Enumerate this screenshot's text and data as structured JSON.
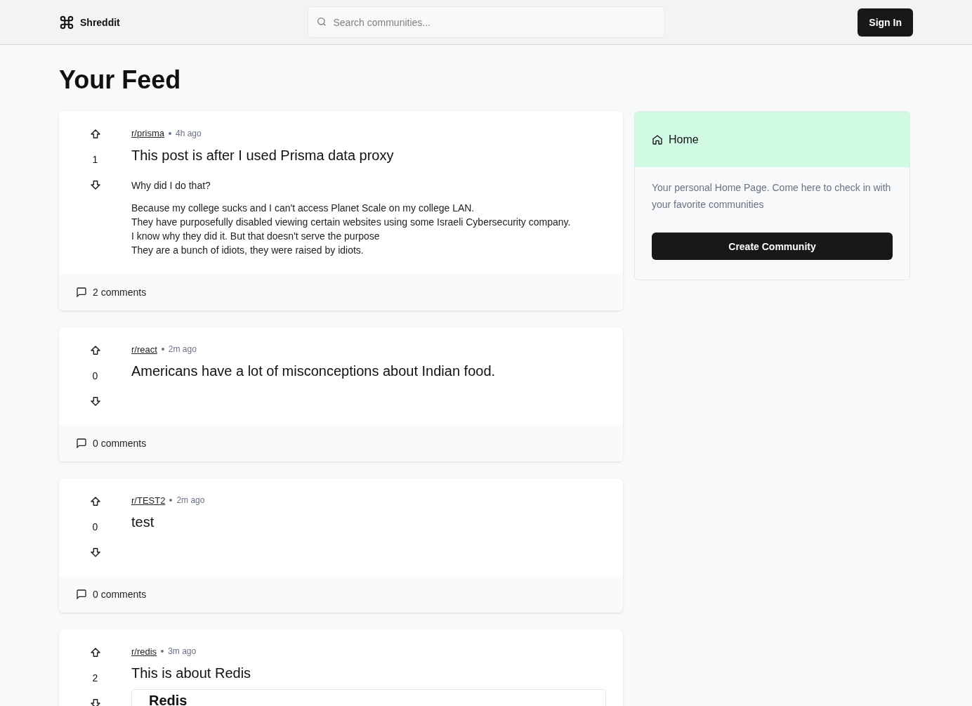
{
  "header": {
    "brand": "Shreddit",
    "search": {
      "placeholder": "Search communities..."
    },
    "sign_in": "Sign In"
  },
  "feed": {
    "title": "Your Feed",
    "posts": [
      {
        "subreddit": "r/prisma",
        "time": "4h ago",
        "title": "This post is after I used Prisma data proxy",
        "votes": "1",
        "paragraphs": [
          [
            "Why did I do that?"
          ],
          [
            "Because my college sucks and I can't access Planet Scale on my college LAN.",
            "They have purposefully disabled viewing certain websites using some Israeli Cybersecurity company.",
            "I know why they did it. But that doesn't serve the purpose",
            "They are a bunch of idiots, they were raised by idiots."
          ]
        ],
        "comments": "2 comments"
      },
      {
        "subreddit": "r/react",
        "time": "2m ago",
        "title": "Americans have a lot of misconceptions about Indian food.",
        "votes": "0",
        "comments": "0 comments"
      },
      {
        "subreddit": "r/TEST2",
        "time": "2m ago",
        "title": "test",
        "votes": "0",
        "comments": "0 comments"
      },
      {
        "subreddit": "r/redis",
        "time": "3m ago",
        "title": "This is about Redis",
        "votes": "2",
        "embed_heading": "Redis"
      }
    ]
  },
  "sidebar": {
    "title": "Home",
    "description": "Your personal Home Page. Come here to check in with your favorite communities",
    "button": "Create Community"
  }
}
